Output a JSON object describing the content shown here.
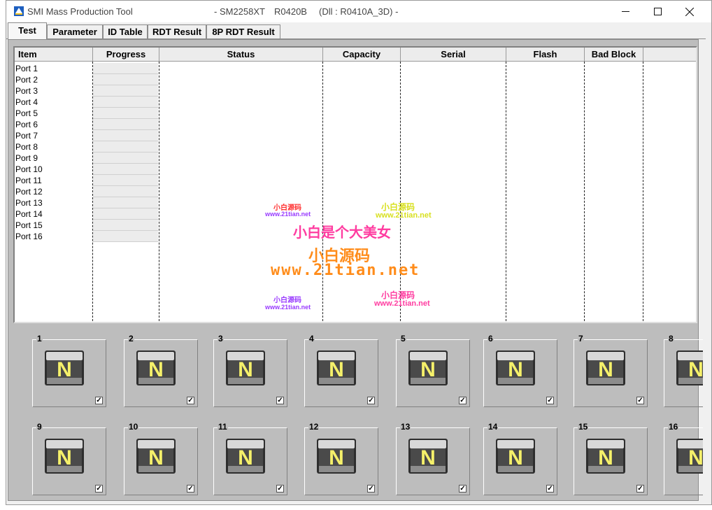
{
  "window": {
    "title": "SMI Mass Production Tool",
    "chip": "- SM2258XT",
    "version": "R0420B",
    "dll": "(Dll : R0410A_3D) -"
  },
  "tabs": [
    {
      "label": "Test",
      "active": true
    },
    {
      "label": "Parameter",
      "active": false
    },
    {
      "label": "ID Table",
      "active": false
    },
    {
      "label": "RDT Result",
      "active": false
    },
    {
      "label": "8P RDT Result",
      "active": false
    }
  ],
  "table": {
    "columns": [
      "Item",
      "Progress",
      "Status",
      "Capacity",
      "Serial",
      "Flash",
      "Bad Block"
    ],
    "rows": [
      "Port 1",
      "Port 2",
      "Port 3",
      "Port 4",
      "Port 5",
      "Port 6",
      "Port 7",
      "Port 8",
      "Port 9",
      "Port 10",
      "Port 11",
      "Port 12",
      "Port 13",
      "Port 14",
      "Port 15",
      "Port 16"
    ]
  },
  "watermark": {
    "small_cn": "小白源码",
    "small_url": "www.21tian.net",
    "headline": "小白是个大美女",
    "big_cn": "小白源码",
    "big_url": "www.21tian.net"
  },
  "slots": [
    {
      "label": "1",
      "letter": "N",
      "checked": true
    },
    {
      "label": "2",
      "letter": "N",
      "checked": true
    },
    {
      "label": "3",
      "letter": "N",
      "checked": true
    },
    {
      "label": "4",
      "letter": "N",
      "checked": true
    },
    {
      "label": "5",
      "letter": "N",
      "checked": true
    },
    {
      "label": "6",
      "letter": "N",
      "checked": true
    },
    {
      "label": "7",
      "letter": "N",
      "checked": true
    },
    {
      "label": "8",
      "letter": "N",
      "checked": true
    },
    {
      "label": "9",
      "letter": "N",
      "checked": true
    },
    {
      "label": "10",
      "letter": "N",
      "checked": true
    },
    {
      "label": "11",
      "letter": "N",
      "checked": true
    },
    {
      "label": "12",
      "letter": "N",
      "checked": true
    },
    {
      "label": "13",
      "letter": "N",
      "checked": true
    },
    {
      "label": "14",
      "letter": "N",
      "checked": true
    },
    {
      "label": "15",
      "letter": "N",
      "checked": true
    },
    {
      "label": "16",
      "letter": "N",
      "checked": true
    }
  ],
  "colors": {
    "slot_letter": "#f5f06a",
    "panel_bg": "#bdbdbd",
    "watermark_pink": "#ff3ca0",
    "watermark_orange": "#ff8c1a",
    "watermark_yellow": "#d8e020",
    "watermark_purple": "#9a3cff"
  }
}
